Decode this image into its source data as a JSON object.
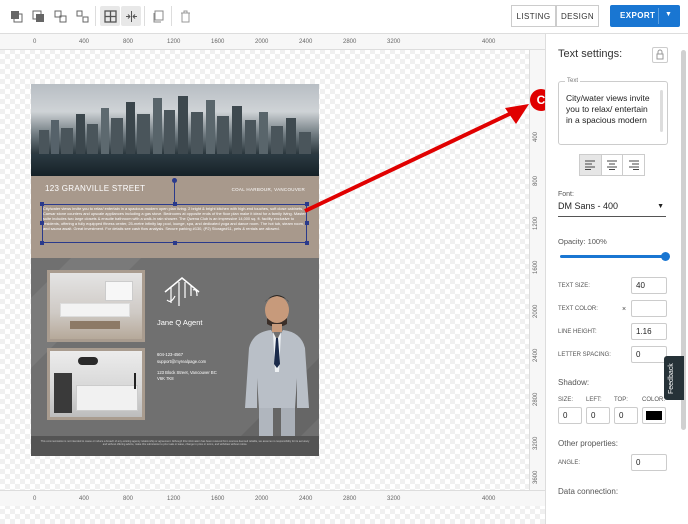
{
  "toolbar": {
    "icons": [
      "bring-front-icon",
      "send-back-icon",
      "group-icon",
      "ungroup-icon",
      "grid-icon",
      "align-center-icon",
      "duplicate-icon",
      "delete-icon"
    ],
    "listing_label": "LISTING",
    "design_label": "DESIGN",
    "export_label": "EXPORT"
  },
  "ruler": {
    "top_ticks": [
      "0",
      "400",
      "800",
      "1200",
      "1600",
      "2000",
      "2400",
      "2800",
      "3200",
      "4000"
    ],
    "bottom_ticks": [
      "0",
      "400",
      "800",
      "1200",
      "1600",
      "2000",
      "2400",
      "2800",
      "3200",
      "4000"
    ],
    "right_ticks": [
      "400",
      "800",
      "1200",
      "1600",
      "2000",
      "2400",
      "2800",
      "3200",
      "3600"
    ]
  },
  "flyer": {
    "address": "123 GRANVILLE STREET",
    "area": "COAL HARBOUR, VANCOUVER",
    "description": "City/water views invite you to relax/ entertain in a spacious modern open plan living. 2 bright & bright kitchen with high-end touches, soft close cabinets, Caesar stone counters and upscale appliances including a gas stove. Bedrooms at opposite ends of the floor plan make it ideal for a family living. Master suite includes two large closets & ensuite bathroom with a walk-in rain shower. The Qwena Club is an impressive 14,000 sq. ft. facility exclusive to residents, offering a fully equipped fitness center, 25-metre infinity lap pool, lounge, spa, and dedicated yoga and dance room. The hot tub, steam room, and sauna await. Great investment. For details see cash flow analysis. Secure parking #130, (P2) Storage#11, pets & rentals are allowed.",
    "agent_name": "Jane Q Agent",
    "phone": "604-123-4567",
    "email": "support@myrealpage.com",
    "office": "123 Block Street, Vancouver BC",
    "postal": "V6K 7K8",
    "disclaimer": "This communication is not intended to cause or induce a breach of any existing agency relationship or agreement. Although this information has been received from sources deemed reliable, we assume no responsibility for its accuracy and without offering advice, make this submission to prior sale or lease, change in price or terms, and withdraw without notice."
  },
  "marker": {
    "letter": "C",
    "color": "#e00000"
  },
  "panel": {
    "title": "Text settings:",
    "text_legend": "Text",
    "text_value": "City/water views invite you to relax/ entertain in a spacious modern",
    "font_label": "Font:",
    "font_value": "DM Sans - 400",
    "opacity_label": "Opacity: 100%",
    "opacity": 1.0,
    "text_size_label": "TEXT SIZE:",
    "text_size": "40",
    "text_color_label": "TEXT COLOR:",
    "text_color_x": "×",
    "text_color": "#ffffff",
    "line_height_label": "LINE HEIGHT:",
    "line_height": "1.16",
    "letter_spacing_label": "LETTER SPACING:",
    "letter_spacing": "0",
    "shadow_label": "Shadow:",
    "shadow_size_label": "SIZE:",
    "shadow_left_label": "LEFT:",
    "shadow_top_label": "TOP:",
    "shadow_color_label": "COLOR:",
    "shadow_size": "0",
    "shadow_left": "0",
    "shadow_top": "0",
    "shadow_color": "#000000",
    "other_label": "Other properties:",
    "angle_label": "ANGLE:",
    "angle": "0",
    "data_connection_label": "Data connection:"
  },
  "feedback_label": "Feedback",
  "colors": {
    "accent": "#1976d2",
    "arrow": "#e00000",
    "selection": "#2a3a8c"
  }
}
